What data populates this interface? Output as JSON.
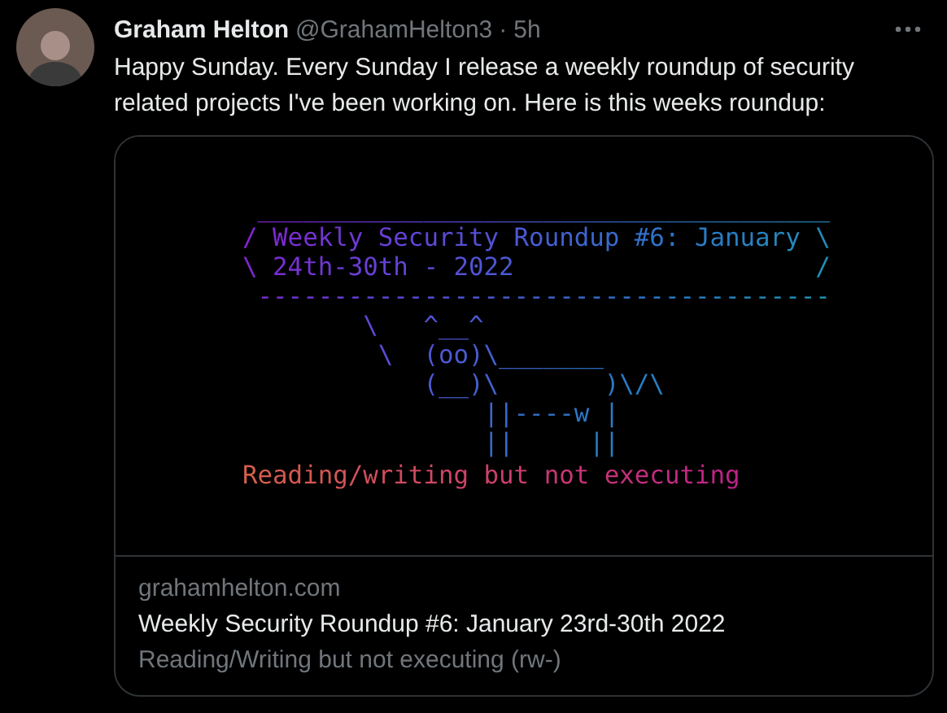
{
  "tweet": {
    "name": "Graham Helton",
    "handle": "@GrahamHelton3",
    "separator": "·",
    "time": "5h",
    "text": "Happy Sunday. Every Sunday I release a weekly roundup of security related projects I've been working on. Here is this weeks roundup:"
  },
  "card": {
    "terminal_lines": [
      " ______________________________________",
      "/ Weekly Security Roundup #6: January \\",
      "\\ 24th-30th - 2022                    /",
      " --------------------------------------",
      "        \\   ^__^",
      "         \\  (oo)\\_______",
      "            (__)\\       )\\/\\",
      "                ||----w |",
      "                ||     ||"
    ],
    "terminal_caption": "Reading/writing but not executing",
    "domain": "grahamhelton.com",
    "title": "Weekly Security Roundup #6: January 23rd-30th 2022",
    "description": "Reading/Writing but not executing (rw-)"
  }
}
